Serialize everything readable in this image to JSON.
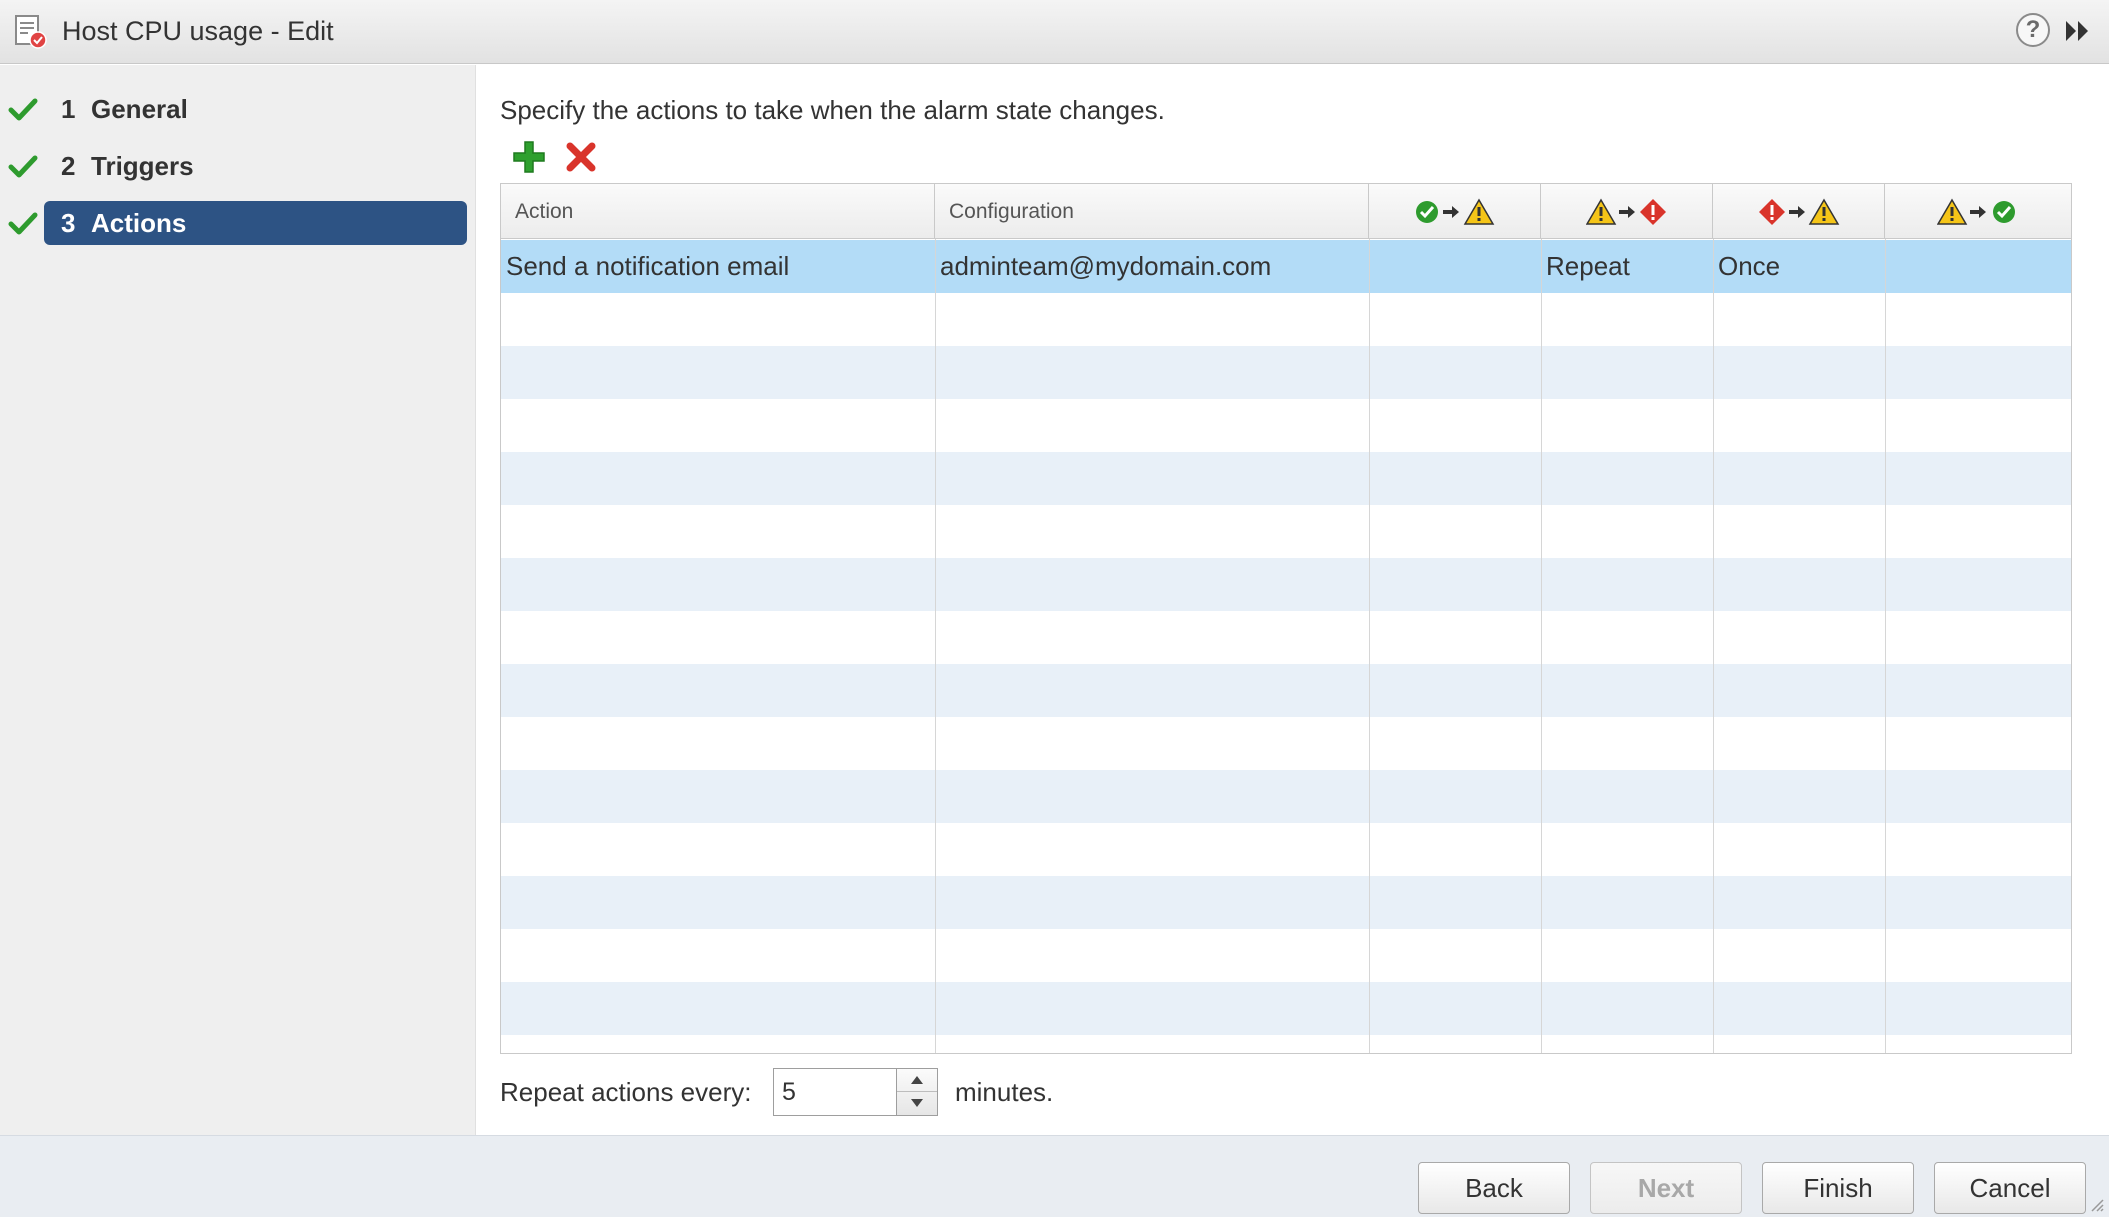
{
  "window": {
    "title": "Host CPU usage - Edit",
    "help_label": "?"
  },
  "steps": [
    {
      "number": "1",
      "label": "General",
      "completed": true,
      "active": false
    },
    {
      "number": "2",
      "label": "Triggers",
      "completed": true,
      "active": false
    },
    {
      "number": "3",
      "label": "Actions",
      "completed": true,
      "active": true
    }
  ],
  "main": {
    "instructions": "Specify the actions to take when the alarm state changes.",
    "toolbar": {
      "add_icon": "add-icon",
      "remove_icon": "remove-icon"
    }
  },
  "table": {
    "columns": [
      {
        "label": "Action"
      },
      {
        "label": "Configuration"
      },
      {
        "icons": [
          "ok-icon",
          "arrow-icon",
          "warning-icon"
        ]
      },
      {
        "icons": [
          "warning-icon",
          "arrow-icon",
          "critical-icon"
        ]
      },
      {
        "icons": [
          "critical-icon",
          "arrow-icon",
          "warning-icon"
        ]
      },
      {
        "icons": [
          "warning-icon",
          "arrow-icon",
          "ok-icon"
        ]
      }
    ],
    "rows": [
      {
        "action": "Send a notification email",
        "configuration": "adminteam@mydomain.com",
        "ok_to_warning": "",
        "warning_to_critical": "Repeat",
        "critical_to_warning": "Once",
        "warning_to_ok": "",
        "selected": true
      }
    ],
    "empty_rows": 14
  },
  "repeat": {
    "label": "Repeat actions every:",
    "value": "5",
    "unit_label": "minutes."
  },
  "footer": {
    "back_label": "Back",
    "next_label": "Next",
    "finish_label": "Finish",
    "cancel_label": "Cancel",
    "next_enabled": false
  },
  "colors": {
    "active_step": "#2d5384",
    "selected_row": "#b3dcf7",
    "alt_row": "#e8f0f8",
    "check_green": "#2e9b2e",
    "add_green": "#2ea02e",
    "remove_red": "#d9342b"
  }
}
